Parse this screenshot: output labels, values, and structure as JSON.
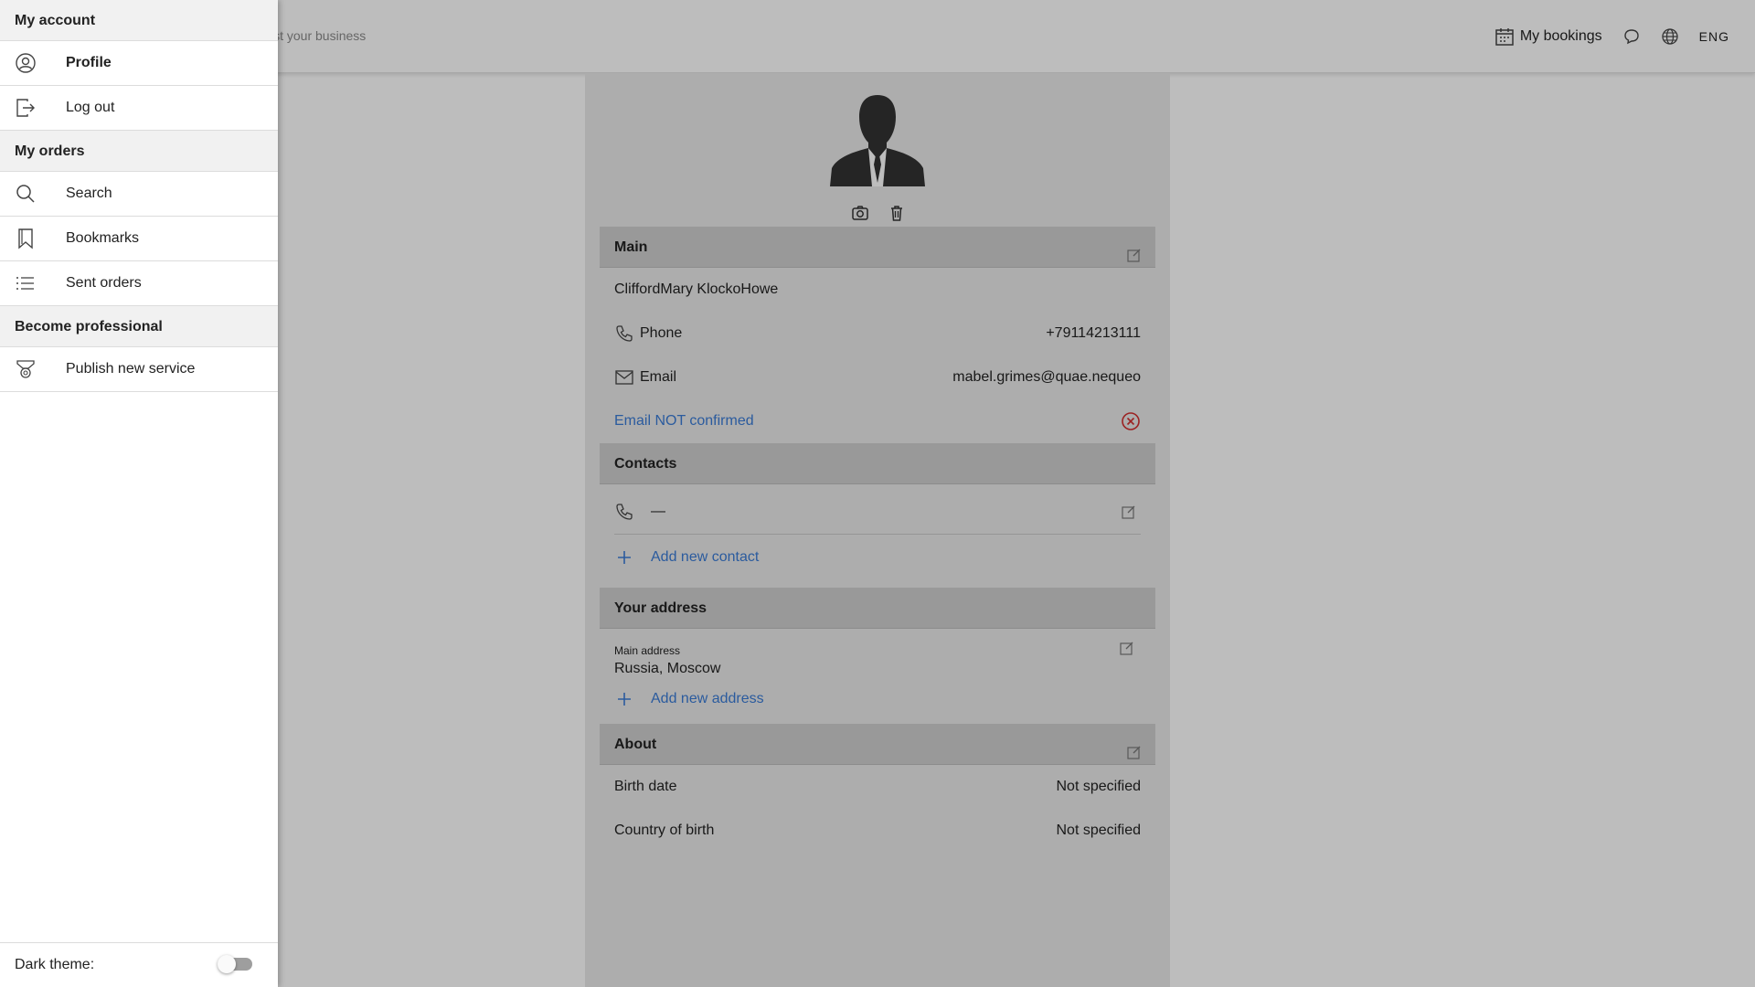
{
  "topbar": {
    "hint": "ist your business",
    "bookings_label": "My bookings",
    "language": "ENG"
  },
  "profile": {
    "main_header": "Main",
    "full_name": "CliffordMary KlockoHowe",
    "phone_label": "Phone",
    "phone_value": "+79114213111",
    "email_label": "Email",
    "email_value": "mabel.grimes@quae.nequeo",
    "email_status": "Email NOT confirmed",
    "contacts_header": "Contacts",
    "contact_value": "—",
    "add_contact": "Add new contact",
    "address_header": "Your address",
    "main_address_label": "Main address",
    "main_address_value": "Russia, Moscow",
    "add_address": "Add new address",
    "about_header": "About",
    "birth_date_label": "Birth date",
    "birth_date_value": "Not specified",
    "country_label": "Country of birth",
    "country_value": "Not specified"
  },
  "drawer": {
    "group_account": "My account",
    "profile": "Profile",
    "logout": "Log out",
    "group_orders": "My orders",
    "search": "Search",
    "bookmarks": "Bookmarks",
    "sent_orders": "Sent orders",
    "group_professional": "Become professional",
    "publish": "Publish new service",
    "dark_theme_label": "Dark theme:",
    "dark_theme_on": false
  },
  "colors": {
    "link": "#3a7bd5",
    "error": "#d32f2f"
  }
}
